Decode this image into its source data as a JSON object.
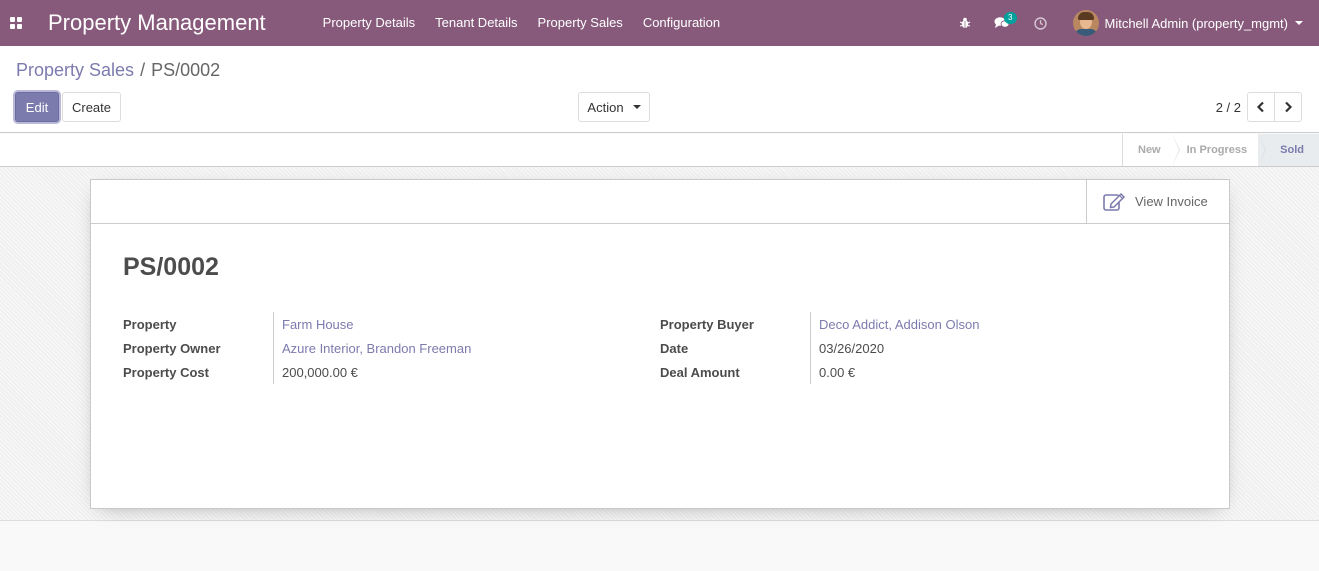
{
  "navbar": {
    "brand": "Property Management",
    "menu": [
      "Property Details",
      "Tenant Details",
      "Property Sales",
      "Configuration"
    ],
    "messages_count": "3",
    "user_name": "Mitchell Admin (property_mgmt)"
  },
  "breadcrumb": {
    "parent": "Property Sales",
    "separator": "/",
    "current": "PS/0002"
  },
  "buttons": {
    "edit": "Edit",
    "create": "Create",
    "action": "Action"
  },
  "pager": {
    "value": "2 / 2"
  },
  "statusbar": {
    "steps": [
      "New",
      "In Progress",
      "Sold"
    ],
    "active": "Sold"
  },
  "stat_button": {
    "label": "View Invoice"
  },
  "record": {
    "name": "PS/0002",
    "left_fields": [
      {
        "label": "Property",
        "value": "Farm House"
      },
      {
        "label": "Property Owner",
        "value": "Azure Interior, Brandon Freeman"
      },
      {
        "label": "Property Cost",
        "value": "200,000.00 €"
      }
    ],
    "right_fields": [
      {
        "label": "Property Buyer",
        "value": "Deco Addict, Addison Olson"
      },
      {
        "label": "Date",
        "value": "03/26/2020"
      },
      {
        "label": "Deal Amount",
        "value": "0.00 €"
      }
    ]
  },
  "colors": {
    "navbar": "#875a7b",
    "primary": "#7c7bad",
    "badge": "#00a09d"
  }
}
